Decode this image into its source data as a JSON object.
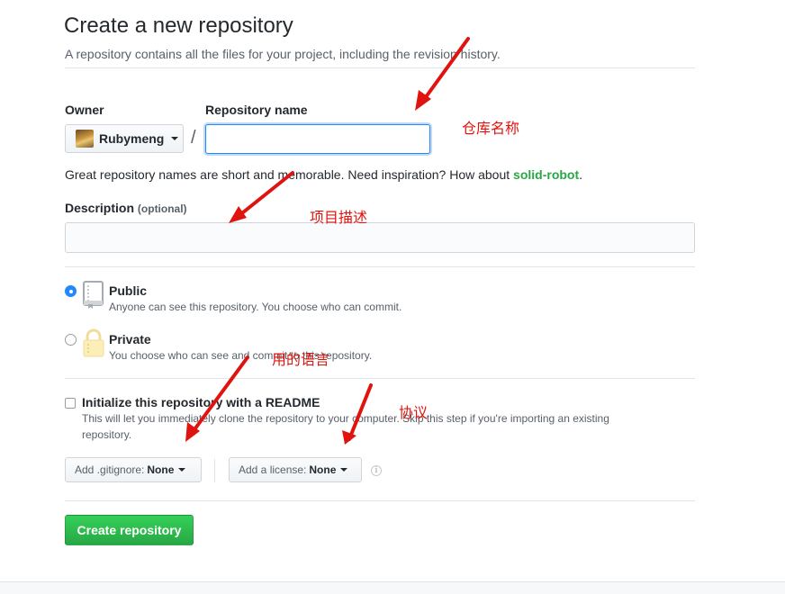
{
  "header": {
    "title": "Create a new repository",
    "subtitle": "A repository contains all the files for your project, including the revision history."
  },
  "owner": {
    "label": "Owner",
    "value": "Rubymeng",
    "separator": "/"
  },
  "repo_name": {
    "label": "Repository name",
    "value": "",
    "placeholder": ""
  },
  "hint": {
    "text": "Great repository names are short and memorable. Need inspiration? How about ",
    "suggestion": "solid-robot",
    "end": "."
  },
  "description": {
    "label": "Description",
    "optional": "(optional)",
    "value": "",
    "placeholder": ""
  },
  "visibility": {
    "public": {
      "title": "Public",
      "desc": "Anyone can see this repository. You choose who can commit.",
      "selected": true
    },
    "private": {
      "title": "Private",
      "desc": "You choose who can see and commit to this repository.",
      "selected": false
    }
  },
  "init": {
    "title": "Initialize this repository with a README",
    "desc_line1": "This will let you immediately clone the repository to your computer. Skip this step if you're importing an existing",
    "desc_line2": "repository.",
    "checked": false
  },
  "gitignore": {
    "prefix": "Add .gitignore:",
    "value": "None"
  },
  "license": {
    "prefix": "Add a license:",
    "value": "None"
  },
  "submit": {
    "label": "Create repository"
  },
  "annotations": {
    "repo_name": "仓库名称",
    "description": "项目描述",
    "language": "用的语言",
    "license": "协议"
  },
  "icons": {
    "info": "info-icon",
    "repo": "repo-book-icon",
    "lock": "lock-icon",
    "caret": "caret-down-icon"
  },
  "colors": {
    "accent": "#2188ff",
    "suggestion": "#28a745",
    "create_button": "#2ea44f",
    "annotation": "#e0140f"
  }
}
